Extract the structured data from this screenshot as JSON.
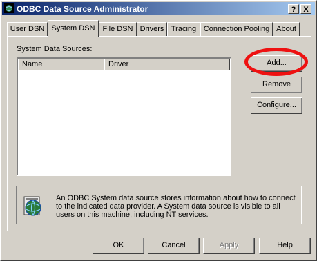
{
  "window": {
    "title": "ODBC Data Source Administrator"
  },
  "titlebar_buttons": {
    "help": "?",
    "close": "X"
  },
  "tabs": [
    {
      "label": "User DSN"
    },
    {
      "label": "System DSN"
    },
    {
      "label": "File DSN"
    },
    {
      "label": "Drivers"
    },
    {
      "label": "Tracing"
    },
    {
      "label": "Connection Pooling"
    },
    {
      "label": "About"
    }
  ],
  "active_tab": "System DSN",
  "system_dsn": {
    "list_label": "System Data Sources:",
    "columns": [
      "Name",
      "Driver"
    ],
    "rows": [],
    "buttons": {
      "add": "Add...",
      "remove": "Remove",
      "configure": "Configure..."
    },
    "description": "An ODBC System data source stores information about how to connect to the indicated data provider.  A System data source is visible to all users on this machine, including NT services.",
    "description_icon": "globe-database-icon"
  },
  "footer_buttons": {
    "ok": "OK",
    "cancel": "Cancel",
    "apply": "Apply",
    "help": "Help"
  },
  "highlight": {
    "target": "add-button",
    "color": "#ee1111"
  }
}
